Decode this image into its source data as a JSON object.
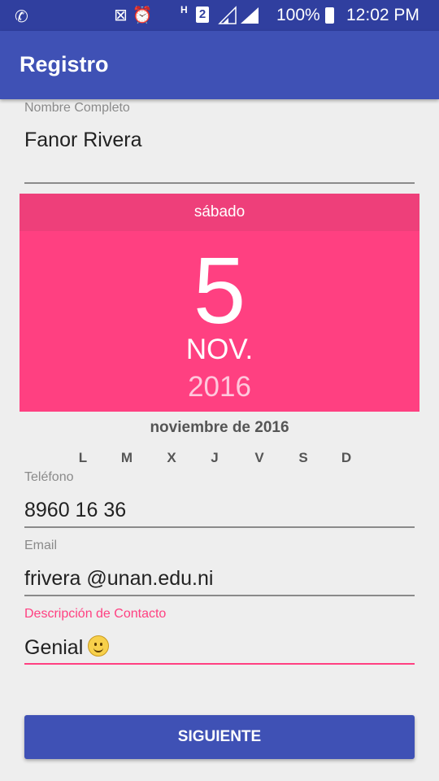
{
  "status_bar": {
    "left_icon": "whatsapp-icon",
    "icons": [
      "vibrate-mute-icon",
      "alarm-icon",
      "h-data-icon",
      "sim2-icon",
      "signal-icon",
      "signal-icon"
    ],
    "sim_badge": "2",
    "battery_percent": "100%",
    "time": "12:02 PM"
  },
  "app_bar": {
    "title": "Registro"
  },
  "form": {
    "name": {
      "label": "Nombre Completo",
      "value": "Fanor Rivera"
    },
    "phone": {
      "label": "Teléfono",
      "value": "8960 16 36"
    },
    "email": {
      "label": "Email",
      "value": "frivera @unan.edu.ni"
    },
    "description": {
      "label": "Descripción de Contacto",
      "value": "Genial"
    }
  },
  "calendar": {
    "weekday": "sábado",
    "day": "5",
    "month": "NOV.",
    "year": "2016",
    "month_title": "noviembre de 2016",
    "weekday_labels": [
      "L",
      "M",
      "X",
      "J",
      "V",
      "S",
      "D"
    ]
  },
  "buttons": {
    "next": "SIGUIENTE"
  },
  "colors": {
    "primary": "#3f51b5",
    "primary_dark": "#303f9f",
    "accent": "#ff4081",
    "accent_header": "#ee3f7a"
  }
}
